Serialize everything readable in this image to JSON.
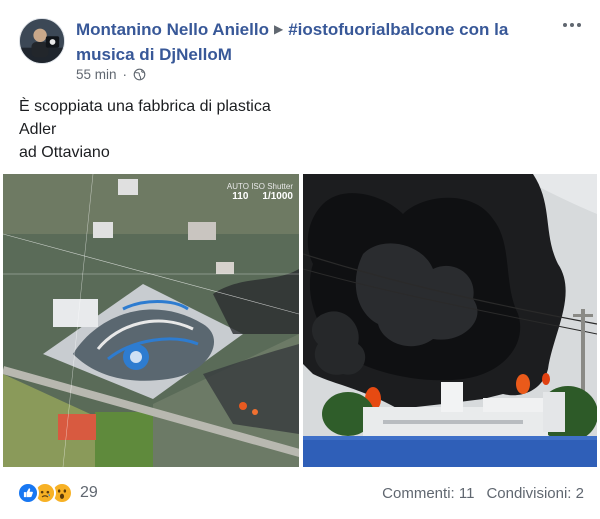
{
  "post": {
    "author": "Montanino Nello Aniello",
    "target": "#iostofuorialbalcone con la musica di DjNelloM",
    "timestamp": "55 min",
    "privacy_icon": "globe-icon",
    "more_icon": "ellipsis-icon",
    "text_lines": [
      "È scoppiata una fabbrica di plastica",
      "Adler",
      "ad Ottaviano"
    ]
  },
  "photo_left": {
    "hud_top": "AUTO ISO  Shutter",
    "hud_iso": "110",
    "hud_shutter": "1/1000"
  },
  "footer": {
    "reaction_icons": [
      "like-icon",
      "sad-icon",
      "wow-icon"
    ],
    "reaction_count": "29",
    "comments": "Commenti: 11",
    "shares": "Condivisioni: 2"
  },
  "colors": {
    "link": "#385898",
    "meta": "#606770",
    "like": "#1877f2",
    "reaction_yellow": "#f7b125"
  }
}
